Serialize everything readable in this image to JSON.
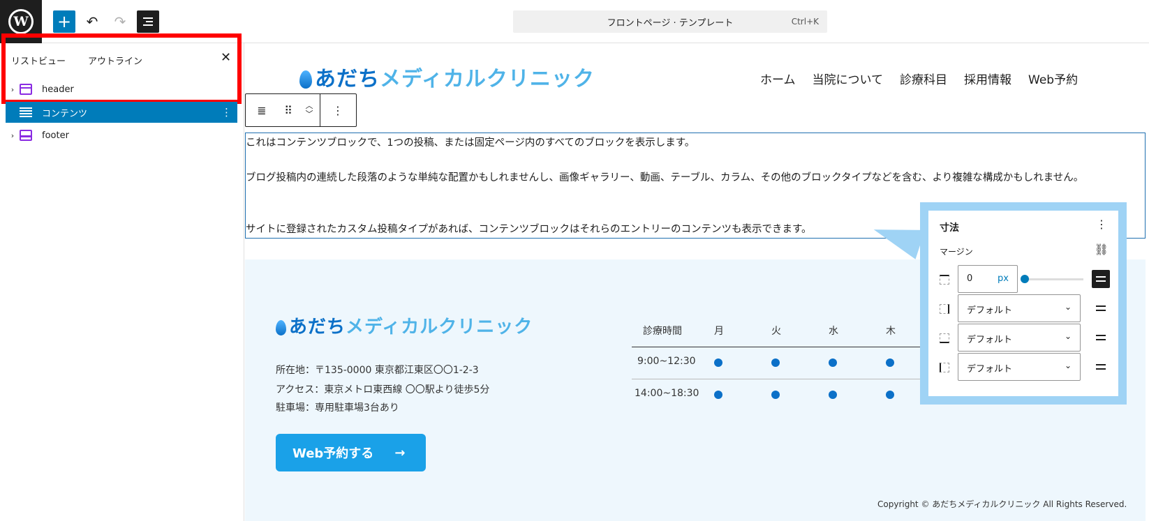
{
  "toolbar": {
    "logo_glyph": "W",
    "add_glyph": "+",
    "undo_glyph": "↶",
    "redo_glyph": "↷",
    "document_title": "フロントページ · テンプレート",
    "shortcut": "Ctrl+K"
  },
  "sidebar": {
    "tabs": [
      "リストビュー",
      "アウトライン"
    ],
    "close_glyph": "✕",
    "items": [
      {
        "label": "header",
        "icon": "template-part-header-icon",
        "expandable": true
      },
      {
        "label": "コンテンツ",
        "icon": "post-content-icon",
        "selected": true
      },
      {
        "label": "footer",
        "icon": "template-part-footer-icon",
        "expandable": true
      }
    ]
  },
  "site": {
    "logo_part_a": "あだち",
    "logo_part_b": "メディカルクリニック",
    "nav": [
      "ホーム",
      "当院について",
      "診療科目",
      "採用情報",
      "Web予約"
    ]
  },
  "content": {
    "p1": "これはコンテンツブロックで、1つの投稿、または固定ページ内のすべてのブロックを表示します。",
    "p2": "ブログ投稿内の連続した段落のような単純な配置かもしれませんし、画像ギャラリー、動画、テーブル、カラム、その他のブロックタイプなどを含む、より複雑な構成かもしれません。",
    "p3": "サイトに登録されたカスタム投稿タイプがあれば、コンテンツブロックはそれらのエントリーのコンテンツも表示できます。"
  },
  "footer": {
    "address": "所在地：〒135-0000 東京都江東区〇〇1-2-3",
    "access": "アクセス：東京メトロ東西線 〇〇駅より徒歩5分",
    "parking": "駐車場：専用駐車場3台あり",
    "cta_label": "Web予約する",
    "cta_arrow": "→",
    "hours_header": [
      "診療時間",
      "月",
      "火",
      "水",
      "木"
    ],
    "hours_rows": [
      {
        "time": "9:00~12:30",
        "open": [
          true,
          true,
          true,
          true
        ]
      },
      {
        "time": "14:00~18:30",
        "open": [
          true,
          true,
          true,
          true
        ]
      }
    ],
    "copyright": "Copyright © あだちメディカルクリニック All Rights Reserved."
  },
  "popover": {
    "title": "寸法",
    "margin_label": "マージン",
    "top_value": "0",
    "top_unit": "px",
    "default_label": "デフォルト",
    "kebab_glyph": "⋮",
    "link_glyph": "⛓"
  },
  "colors": {
    "accent": "#007cba",
    "highlight": "#ff0000",
    "callout": "#9fd3f5"
  }
}
